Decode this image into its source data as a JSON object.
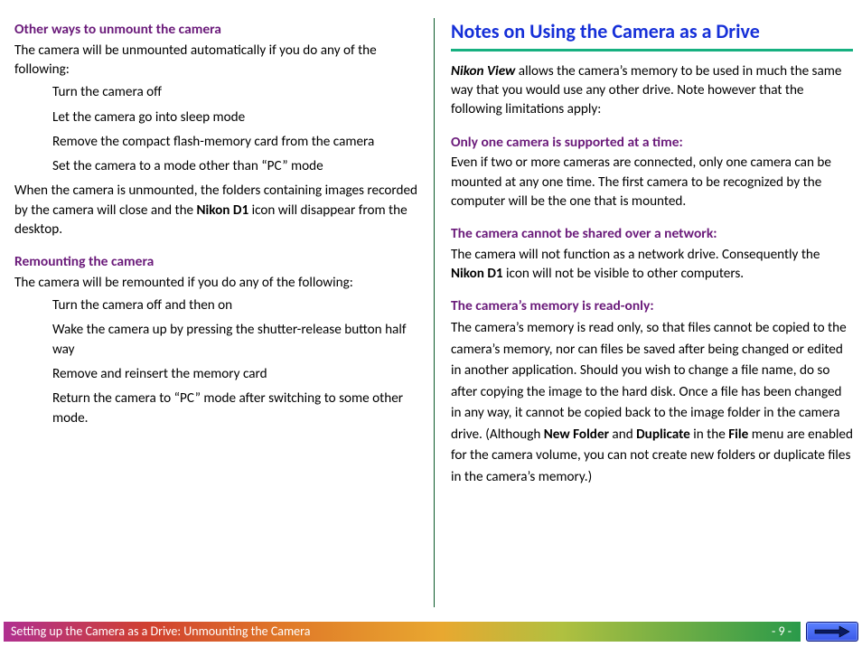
{
  "left": {
    "h1": "Other ways to unmount the camera",
    "p1": "The camera will be unmounted automatically if you do any of the following:",
    "list1": [
      "Turn the camera off",
      "Let the camera go into sleep mode",
      "Remove the compact flash-memory card from the cam­era",
      "Set the camera to a mode other than “PC” mode"
    ],
    "p2a": "When the camera is unmounted, the folders containing images recorded by the camera will close and the ",
    "p2b": "Nikon D1",
    "p2c": " icon will disappear from the desktop.",
    "h2": "Remounting the camera",
    "p3": "The camera will be remounted if you do any of the following:",
    "list2": [
      "Turn the camera off and then on",
      "Wake the camera up by pressing the shutter-release button half way",
      "Remove and reinsert the memory card",
      "Return the camera to “PC” mode after switching to some other mode."
    ]
  },
  "right": {
    "title": "Notes on Using the Camera as a Drive",
    "intro_a": "Nikon View",
    "intro_b": " allows the camera’s memory to be used in much the same way that you would use any other drive.  Note however that the following limitations apply:",
    "s1h": "Only one camera is supported at a time:",
    "s1p": "Even if two or more cameras are connected, only one camera can be mounted at any one time. The first camera to be recog­nized by the computer will be the one that is mounted.",
    "s2h": "The camera cannot be shared over a network:",
    "s2p_a": "The camera will not function as a network drive.  Consequently the ",
    "s2p_b": "Nikon D1",
    "s2p_c": " icon will not be visible to other computers.",
    "s3h": "The camera’s memory is read-only:",
    "s3p_a": "The camera’s memory is read only, so that files cannot be copied to the camera’s memory, nor can files be saved after being changed or edited in another application. Should you wish to change a file name, do so after copying the image to the hard disk. Once a file has been changed in any way, it cannot be copied back to the image folder in the camera drive.  (Although ",
    "s3p_b": "New Folder",
    "s3p_c": " and ",
    "s3p_d": "Duplicate",
    "s3p_e": " in the ",
    "s3p_f": "File",
    "s3p_g": " menu are enabled for the camera volume, you can not create new folders or duplicate files in the camera’s memory.)"
  },
  "footer": {
    "crumb": "Setting up the Camera as a Drive:  Unmounting the Camera",
    "page": "- 9 -"
  }
}
